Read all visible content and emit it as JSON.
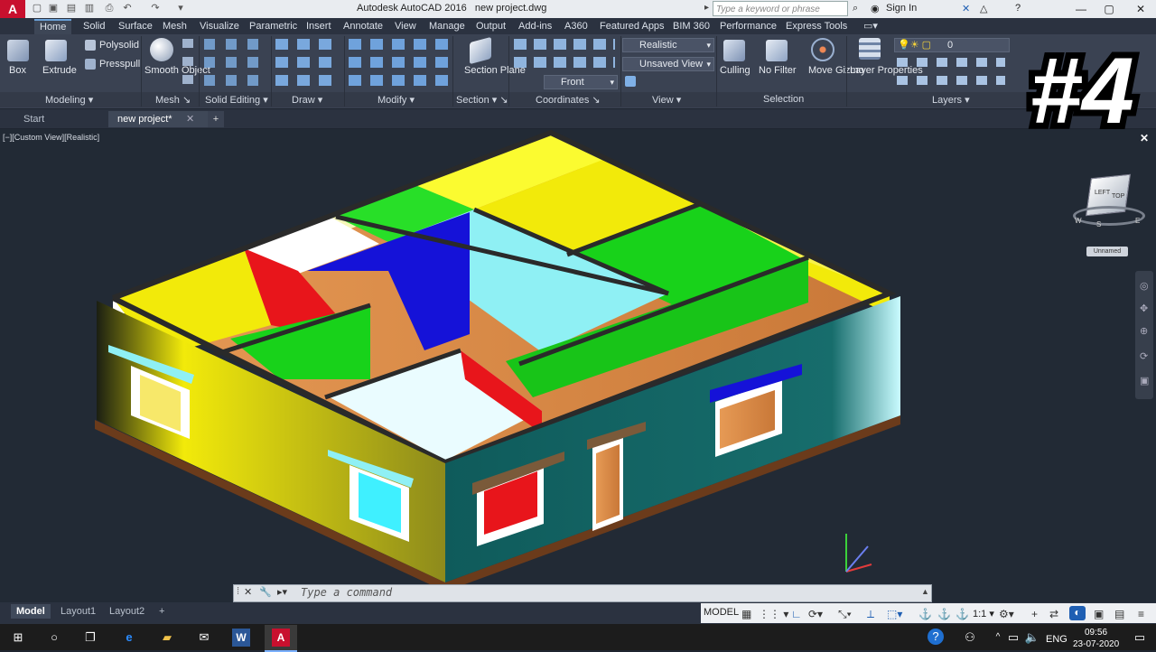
{
  "window": {
    "app_title": "Autodesk AutoCAD 2016",
    "file_name": "new project.dwg",
    "search_placeholder": "Type a keyword or phrase",
    "sign_in": "Sign In",
    "app_logo": "A"
  },
  "ribbon_tabs": [
    "Home",
    "Solid",
    "Surface",
    "Mesh",
    "Visualize",
    "Parametric",
    "Insert",
    "Annotate",
    "View",
    "Manage",
    "Output",
    "Add-ins",
    "A360",
    "Featured Apps",
    "BIM 360",
    "Performance",
    "Express Tools"
  ],
  "ribbon": {
    "modeling": {
      "label": "Modeling",
      "box": "Box",
      "extrude": "Extrude",
      "polysolid": "Polysolid",
      "presspull": "Presspull"
    },
    "mesh": {
      "label": "Mesh",
      "smooth_object": "Smooth Object"
    },
    "solid_editing": {
      "label": "Solid Editing"
    },
    "draw": {
      "label": "Draw"
    },
    "modify": {
      "label": "Modify"
    },
    "section": {
      "label": "Section",
      "section_plane": "Section Plane"
    },
    "coordinates": {
      "label": "Coordinates",
      "front": "Front"
    },
    "view": {
      "label": "View",
      "visual_style": "Realistic",
      "saved_view": "Unsaved View"
    },
    "selection": {
      "label": "Selection",
      "culling": "Culling",
      "no_filter": "No Filter",
      "move_gizmo": "Move Gizmo"
    },
    "layers": {
      "label": "Layers",
      "layer_properties": "Layer Properties",
      "current_layer": "0"
    }
  },
  "file_tabs": {
    "start": "Start",
    "active": "new project*"
  },
  "viewport": {
    "label": "[−][Custom View][Realistic]",
    "viewcube_top": "TOP",
    "viewcube_left": "LEFT",
    "compass_w": "W",
    "compass_s": "S",
    "compass_e": "E",
    "ucs_name": "Unnamed"
  },
  "overlay_badge": "#4",
  "command_line": {
    "placeholder": "Type a command"
  },
  "layout_tabs": [
    "Model",
    "Layout1",
    "Layout2"
  ],
  "status": {
    "model": "MODEL",
    "scale": "1:1"
  },
  "taskbar": {
    "language": "ENG",
    "time": "09:56",
    "date": "23-07-2020"
  },
  "colors": {
    "accent": "#6aa0d6",
    "wall_yellow": "#f2ea0a",
    "wall_green": "#18d21a",
    "wall_blue": "#1512d8",
    "wall_red": "#e8151b",
    "wall_cyan": "#8ff0f4",
    "floor_wood": "#d98a4a"
  }
}
